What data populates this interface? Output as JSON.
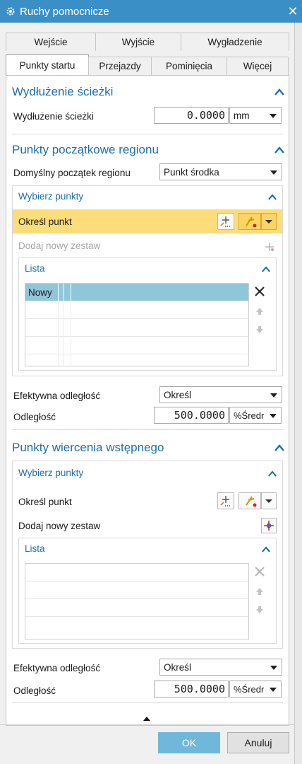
{
  "window": {
    "title": "Ruchy pomocnicze",
    "close_glyph": "✕"
  },
  "tabs_row1": [
    "Wejście",
    "Wyjście",
    "Wygładzenie"
  ],
  "tabs_row2": [
    "Punkty startu",
    "Przejazdy",
    "Pominięcia",
    "Więcej"
  ],
  "active_tab": "Punkty startu",
  "path_ext": {
    "title": "Wydłużenie ścieżki",
    "label": "Wydłużenie ścieżki",
    "value": "0.0000",
    "unit": "mm"
  },
  "region": {
    "title": "Punkty początkowe regionu",
    "default_label": "Domyślny początek regionu",
    "default_value": "Punkt środka",
    "select_group": {
      "title": "Wybierz punkty",
      "specify_label": "Określ punkt",
      "add_set_label": "Dodaj nowy zestaw",
      "list_title": "Lista",
      "list_rows": [
        "Nowy",
        "",
        "",
        "",
        ""
      ]
    },
    "effective_label": "Efektywna odległość",
    "effective_value": "Określ",
    "distance_label": "Odległość",
    "distance_value": "500.0000",
    "distance_unit": "%Średr"
  },
  "predrill": {
    "title": "Punkty wiercenia wstępnego",
    "select_group": {
      "title": "Wybierz punkty",
      "specify_label": "Określ punkt",
      "add_set_label": "Dodaj nowy zestaw",
      "list_title": "Lista",
      "list_rows": [
        "",
        "",
        "",
        "",
        ""
      ]
    },
    "effective_label": "Efektywna odległość",
    "effective_value": "Określ",
    "distance_label": "Odległość",
    "distance_value": "500.0000",
    "distance_unit": "%Średr"
  },
  "buttons": {
    "ok": "OK",
    "cancel": "Anuluj"
  },
  "colors": {
    "titlebar": "#3a8fc6",
    "accent_text": "#1f6fa8",
    "highlight": "#fddc7a",
    "selected_row": "#8fc6d8",
    "ok_button": "#6fb8dc"
  },
  "icons": [
    "gear-icon",
    "close-icon",
    "chevron-up-icon",
    "point-dialog-icon",
    "snap-point-icon",
    "add-set-icon",
    "delete-icon",
    "move-up-icon",
    "move-down-icon",
    "collapse-arrow-icon"
  ]
}
